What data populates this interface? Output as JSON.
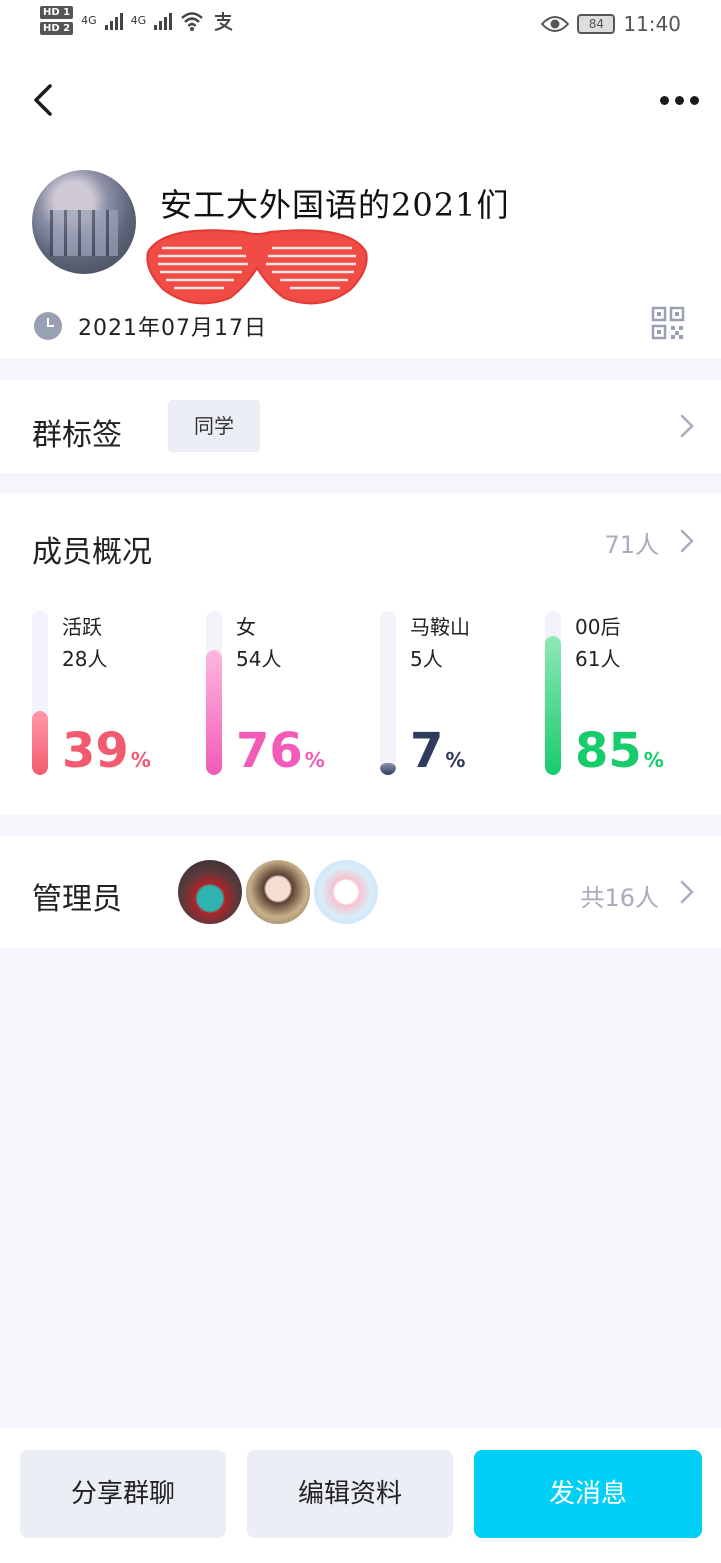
{
  "status_bar": {
    "hd1": "HD 1",
    "hd2": "HD 2",
    "net1": "4G",
    "net2": "4G",
    "battery": "84",
    "time": "11:40",
    "signal-icons": [
      "wifi-icon",
      "alipay-icon",
      "eye-icon"
    ]
  },
  "header": {
    "group_name": "安工大外国语的2021们",
    "created_date": "2021年07月17日"
  },
  "tags": {
    "title": "群标签",
    "tag": "同学"
  },
  "members": {
    "title": "成员概况",
    "count": "71人",
    "stats": [
      {
        "label": "活跃",
        "sub": "28人",
        "percent": 39,
        "unit": "%",
        "color": "#f25b6f",
        "color_light": "#ff9aa8"
      },
      {
        "label": "女",
        "sub": "54人",
        "percent": 76,
        "unit": "%",
        "color": "#f25bb7",
        "color_light": "#ffb8df"
      },
      {
        "label": "马鞍山",
        "sub": "5人",
        "percent": 7,
        "unit": "%",
        "color": "#2e3b5c",
        "color_light": "#8893ad"
      },
      {
        "label": "00后",
        "sub": "61人",
        "percent": 85,
        "unit": "%",
        "color": "#17cc6c",
        "color_light": "#8fe8b7"
      }
    ]
  },
  "admins": {
    "title": "管理员",
    "count": "共16人"
  },
  "actions": {
    "share": "分享群聊",
    "edit": "编辑资料",
    "send": "发消息"
  }
}
